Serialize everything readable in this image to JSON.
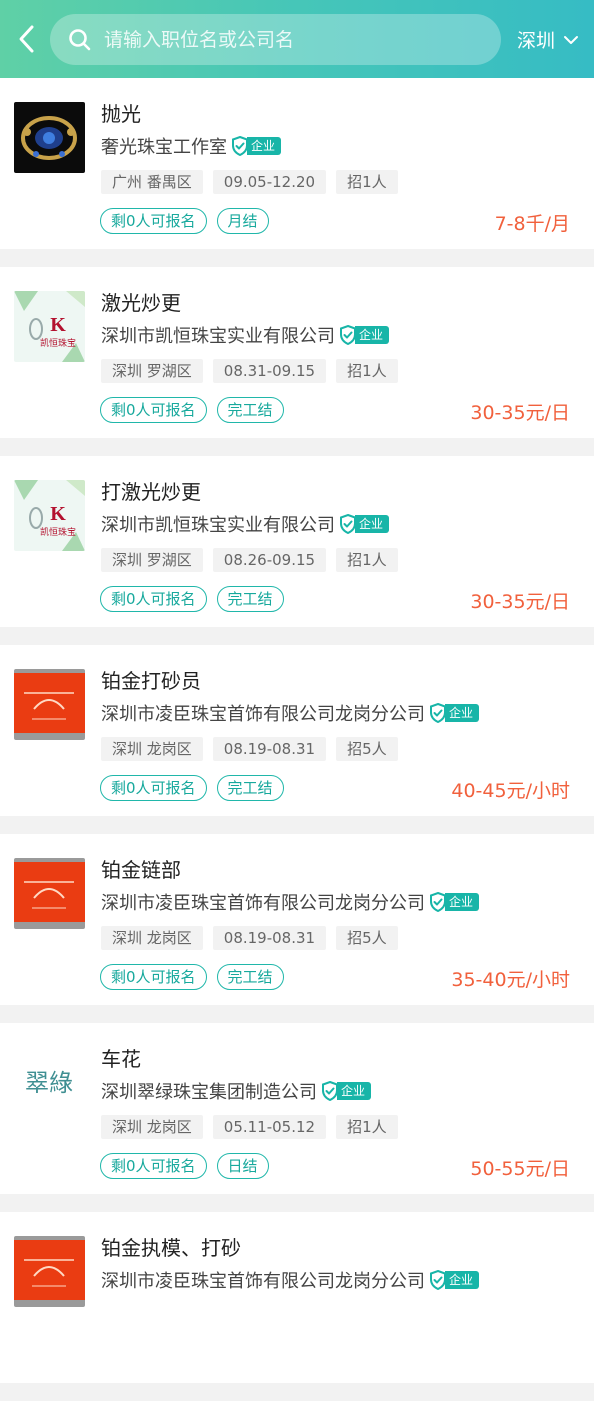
{
  "header": {
    "search_placeholder": "请输入职位名或公司名",
    "city": "深圳",
    "gradient": [
      "#5fd0a6",
      "#36bcc4"
    ]
  },
  "colors": {
    "accent": "#18b5a8",
    "salary": "#f1603c"
  },
  "jobs": [
    {
      "title": "抛光",
      "company": "奢光珠宝工作室",
      "badge": "企业",
      "location": "广州 番禺区",
      "dates": "09.05-12.20",
      "hire": "招1人",
      "remaining": "剩0人可报名",
      "settle": "月结",
      "salary": "7-8千/月",
      "logo": "jewelry-photo"
    },
    {
      "title": "激光炒更",
      "company": "深圳市凯恒珠宝实业有限公司",
      "badge": "企业",
      "location": "深圳 罗湖区",
      "dates": "08.31-09.15",
      "hire": "招1人",
      "remaining": "剩0人可报名",
      "settle": "完工结",
      "salary": "30-35元/日",
      "logo": "kaiheng",
      "logo_text": "凯恒珠宝"
    },
    {
      "title": "打激光炒更",
      "company": "深圳市凯恒珠宝实业有限公司",
      "badge": "企业",
      "location": "深圳 罗湖区",
      "dates": "08.26-09.15",
      "hire": "招1人",
      "remaining": "剩0人可报名",
      "settle": "完工结",
      "salary": "30-35元/日",
      "logo": "kaiheng",
      "logo_text": "凯恒珠宝"
    },
    {
      "title": "铂金打砂员",
      "company": "深圳市凌臣珠宝首饰有限公司龙岗分公司",
      "badge": "企业",
      "location": "深圳 龙岗区",
      "dates": "08.19-08.31",
      "hire": "招5人",
      "remaining": "剩0人可报名",
      "settle": "完工结",
      "salary": "40-45元/小时",
      "logo": "lingchen"
    },
    {
      "title": "铂金链部",
      "company": "深圳市凌臣珠宝首饰有限公司龙岗分公司",
      "badge": "企业",
      "location": "深圳 龙岗区",
      "dates": "08.19-08.31",
      "hire": "招5人",
      "remaining": "剩0人可报名",
      "settle": "完工结",
      "salary": "35-40元/小时",
      "logo": "lingchen"
    },
    {
      "title": "车花",
      "company": "深圳翠绿珠宝集团制造公司",
      "badge": "企业",
      "location": "深圳 龙岗区",
      "dates": "05.11-05.12",
      "hire": "招1人",
      "remaining": "剩0人可报名",
      "settle": "日结",
      "salary": "50-55元/日",
      "logo": "cuilv",
      "logo_text": "翠綠"
    },
    {
      "title": "铂金执模、打砂",
      "company": "深圳市凌臣珠宝首饰有限公司龙岗分公司",
      "badge": "企业",
      "location": "",
      "dates": "",
      "hire": "",
      "remaining": "",
      "settle": "",
      "salary": "",
      "logo": "lingchen"
    }
  ]
}
